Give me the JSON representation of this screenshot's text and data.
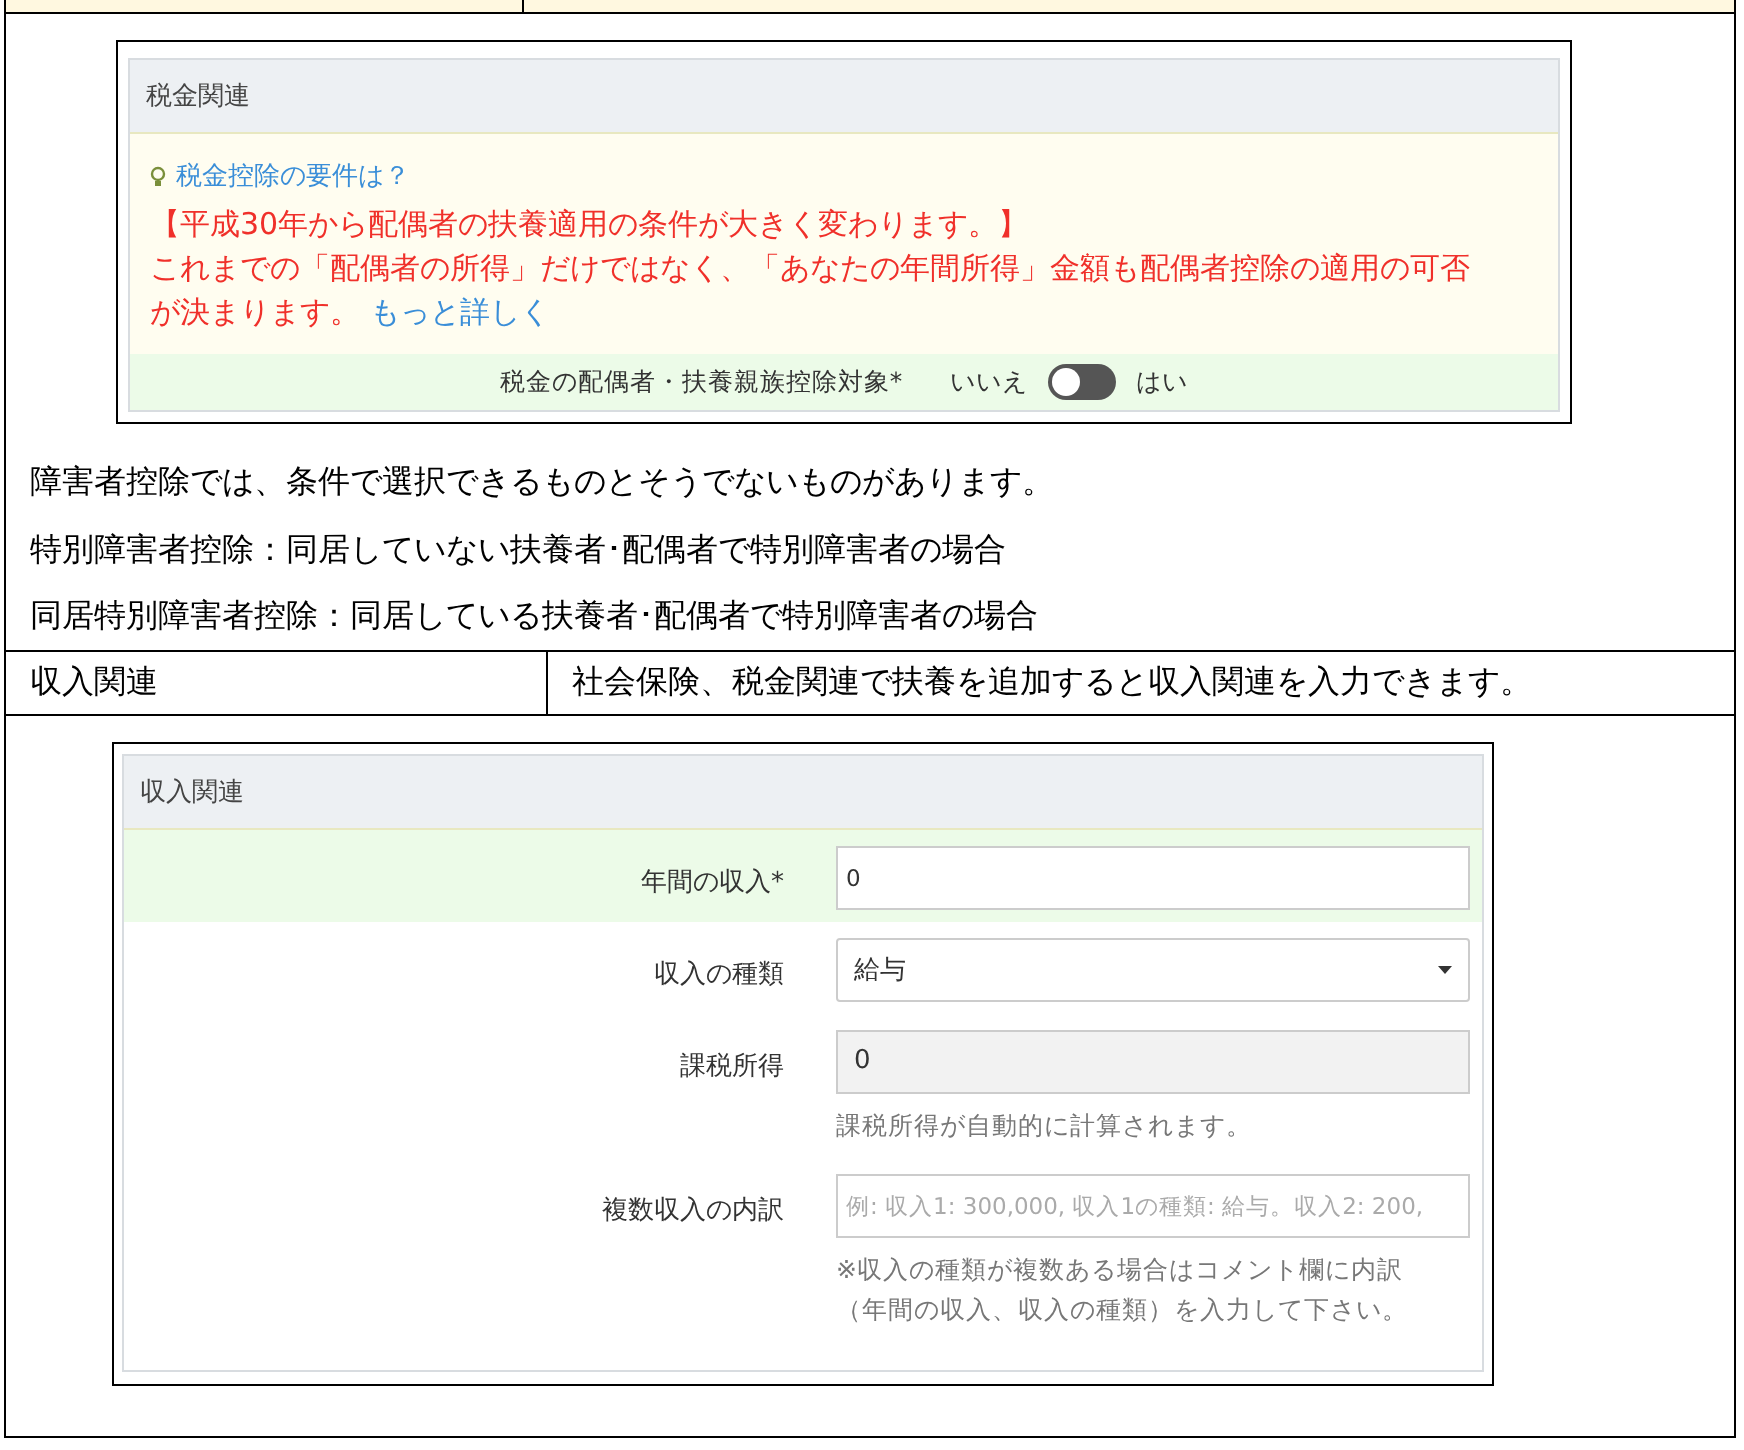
{
  "tax_panel": {
    "title": "税金関連",
    "hint_link": "税金控除の要件は？",
    "notice_heading": "【平成30年から配偶者の扶養適用の条件が大きく変わります。】",
    "notice_body": "これまでの「配偶者の所得」だけではなく、「あなたの年間所得」金額も配偶者控除の適用の可否が決まります。",
    "more_link": "もっと詳しく",
    "toggle_label": "税金の配偶者・扶養親族控除対象*",
    "toggle_off_text": "いいえ",
    "toggle_on_text": "はい",
    "toggle_on": false
  },
  "notes": [
    "障害者控除では、条件で選択できるものとそうでないものがあります。",
    "特別障害者控除：同居していない扶養者･配偶者で特別障害者の場合",
    "同居特別障害者控除：同居している扶養者･配偶者で特別障害者の場合"
  ],
  "income_row": {
    "label": "収入関連",
    "description": "社会保険、税金関連で扶養を追加すると収入関連を入力できます。"
  },
  "income_panel": {
    "title": "収入関連",
    "fields": [
      {
        "kind": "input",
        "label": "年間の収入*",
        "value": "0",
        "highlighted": true
      },
      {
        "kind": "select",
        "label": "収入の種類",
        "value": "給与",
        "highlighted": false
      },
      {
        "kind": "readonly",
        "label": "課税所得",
        "value": "0",
        "help": [
          "課税所得が自動的に計算されます。"
        ],
        "highlighted": false
      },
      {
        "kind": "input",
        "label": "複数収入の内訳",
        "placeholder": "例: 収入1: 300,000, 収入1の種類: 給与。収入2: 200,",
        "help": [
          "※収入の種類が複数ある場合はコメント欄に内訳",
          "（年間の収入、収入の種類）を入力して下さい。"
        ],
        "highlighted": false
      }
    ]
  }
}
